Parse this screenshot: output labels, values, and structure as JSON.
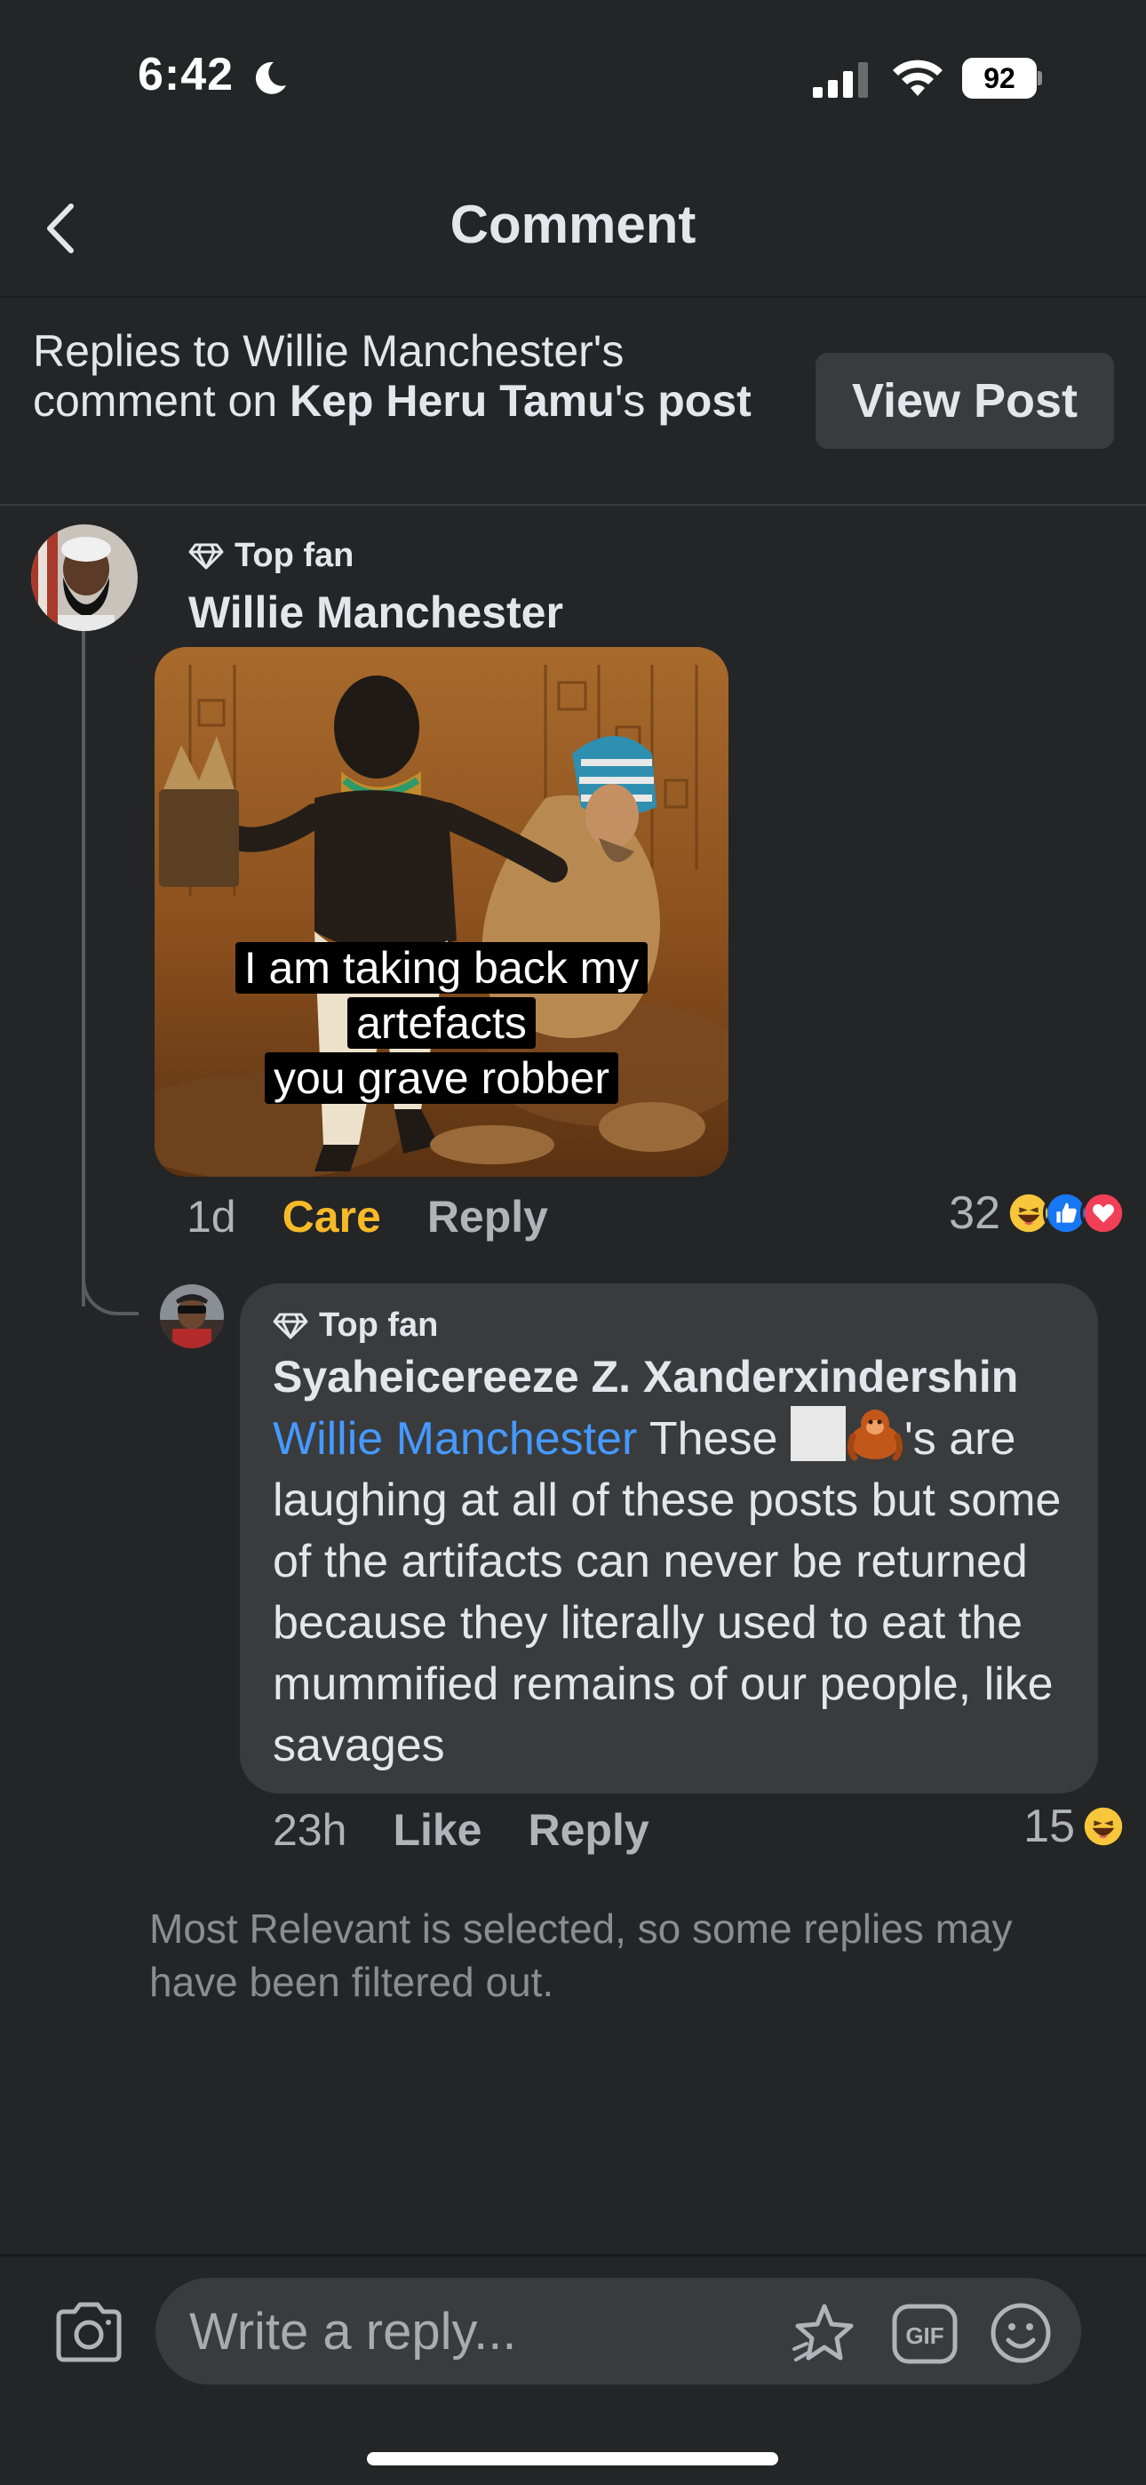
{
  "status_bar": {
    "time": "6:42",
    "battery": "92"
  },
  "header": {
    "title": "Comment"
  },
  "banner": {
    "prefix": "Replies to Willie Manchester's comment on ",
    "page_name": "Kep Heru Tamu",
    "possessive": "'s ",
    "post_word": "post",
    "view_post_label": "View Post"
  },
  "main_comment": {
    "badge": "Top fan",
    "author": "Willie Manchester",
    "image_caption": [
      "I am taking back my",
      "artefacts",
      "you grave robber"
    ],
    "age": "1d",
    "reaction_label": "Care",
    "reply_label": "Reply",
    "reaction_count": "32"
  },
  "reply_comment": {
    "badge": "Top fan",
    "author": "Syaheicereeze Z. Xanderxindershin",
    "mention": "Willie Manchester",
    "text_before_emoji": " These ",
    "text_after_emoji": "'s are laughing at all of these posts but some of the artifacts can never be returned because they literally used to eat the mummified remains of our people, like savages",
    "age": "23h",
    "like_label": "Like",
    "reply_label": "Reply",
    "reaction_count": "15"
  },
  "filter_note": "Most Relevant is selected, so some replies may have been filtered out.",
  "composer": {
    "placeholder": "Write a reply..."
  },
  "colors": {
    "background": "#242526",
    "bubble": "#3a3b3c",
    "mention": "#4599ff",
    "care": "#f7b928",
    "secondary_text": "#b0b3b8"
  }
}
